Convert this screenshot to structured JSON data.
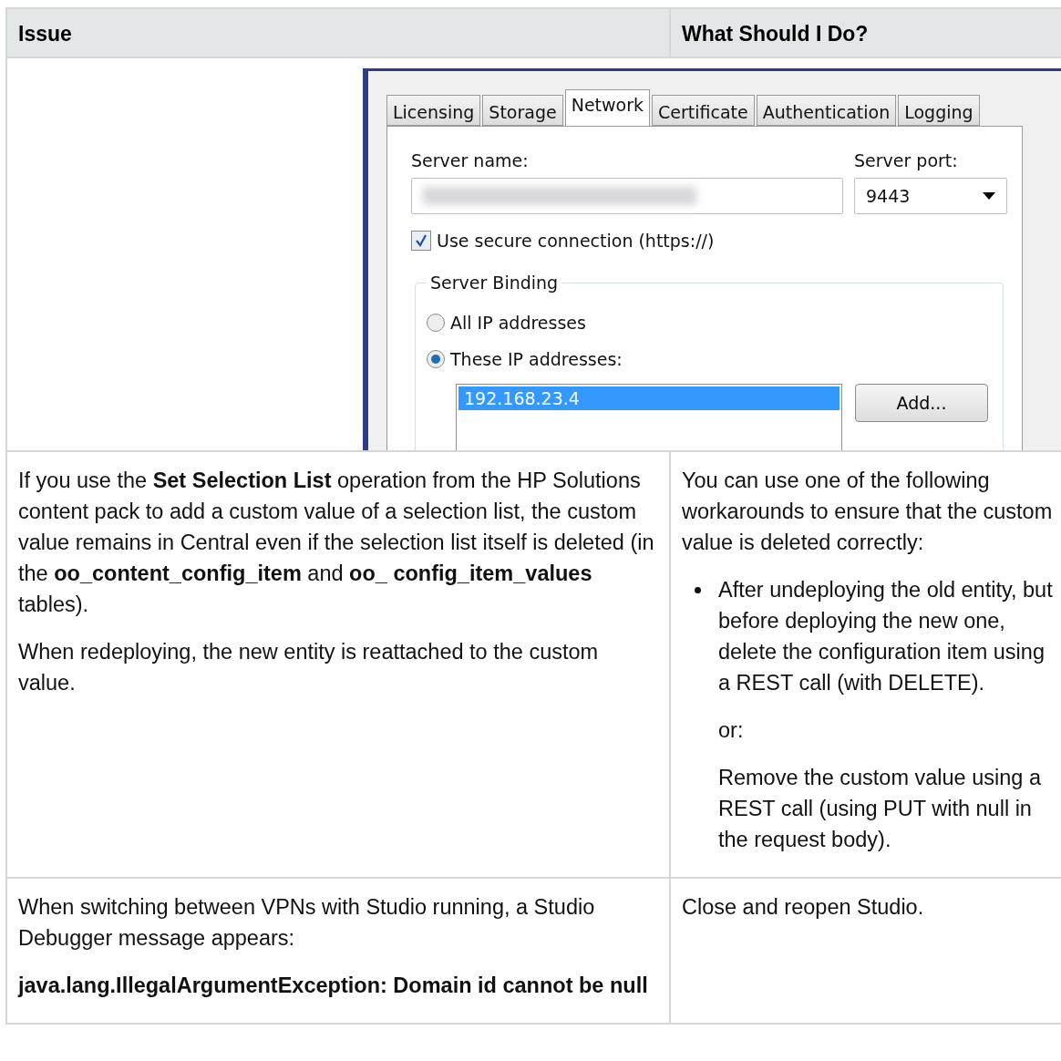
{
  "table": {
    "columns": [
      "Issue",
      "What Should I Do?"
    ],
    "screenshot": {
      "tabs": [
        {
          "label": "Licensing",
          "selected": false
        },
        {
          "label": "Storage",
          "selected": false
        },
        {
          "label": "Network",
          "selected": true
        },
        {
          "label": "Certificate",
          "selected": false
        },
        {
          "label": "Authentication",
          "selected": false
        },
        {
          "label": "Logging",
          "selected": false
        }
      ],
      "server_name_label": "Server name:",
      "server_port_label": "Server port:",
      "server_port_value": "9443",
      "secure_connection": {
        "label": "Use secure connection (https://)",
        "checked": true
      },
      "binding_title": "Server Binding",
      "radios": [
        {
          "label": "All IP addresses",
          "selected": false
        },
        {
          "label": "These IP addresses:",
          "selected": true
        }
      ],
      "ip_list": [
        {
          "value": "192.168.23.4",
          "selected": true
        }
      ],
      "add_button": "Add..."
    },
    "rows": [
      {
        "issue": [
          "If you use the **Set Selection List** operation from the HP Solutions content pack to add a custom value of a selection list, the custom value remains in Central even if the selection list itself is deleted (in the **oo_content_config_item** and **oo_ config_item_values** tables).",
          "When redeploying, the new entity is reattached to the custom value."
        ],
        "action": [
          {
            "kind": "paragraph",
            "text": "You can use one of the following workarounds to ensure that the custom value is deleted correctly:"
          },
          {
            "kind": "bullet",
            "paragraphs": [
              "After undeploying the old entity, but before deploying the new one, delete the configuration item using a REST call (with DELETE).",
              "or:",
              "Remove the custom value using a REST call (using PUT with null in the request body)."
            ]
          }
        ]
      },
      {
        "issue": [
          "When switching between VPNs with Studio running, a Studio Debugger message appears:",
          "**java.lang.IllegalArgumentException: Domain id cannot be null**"
        ],
        "action": [
          {
            "kind": "paragraph",
            "text": "Close and reopen Studio."
          }
        ]
      }
    ]
  }
}
